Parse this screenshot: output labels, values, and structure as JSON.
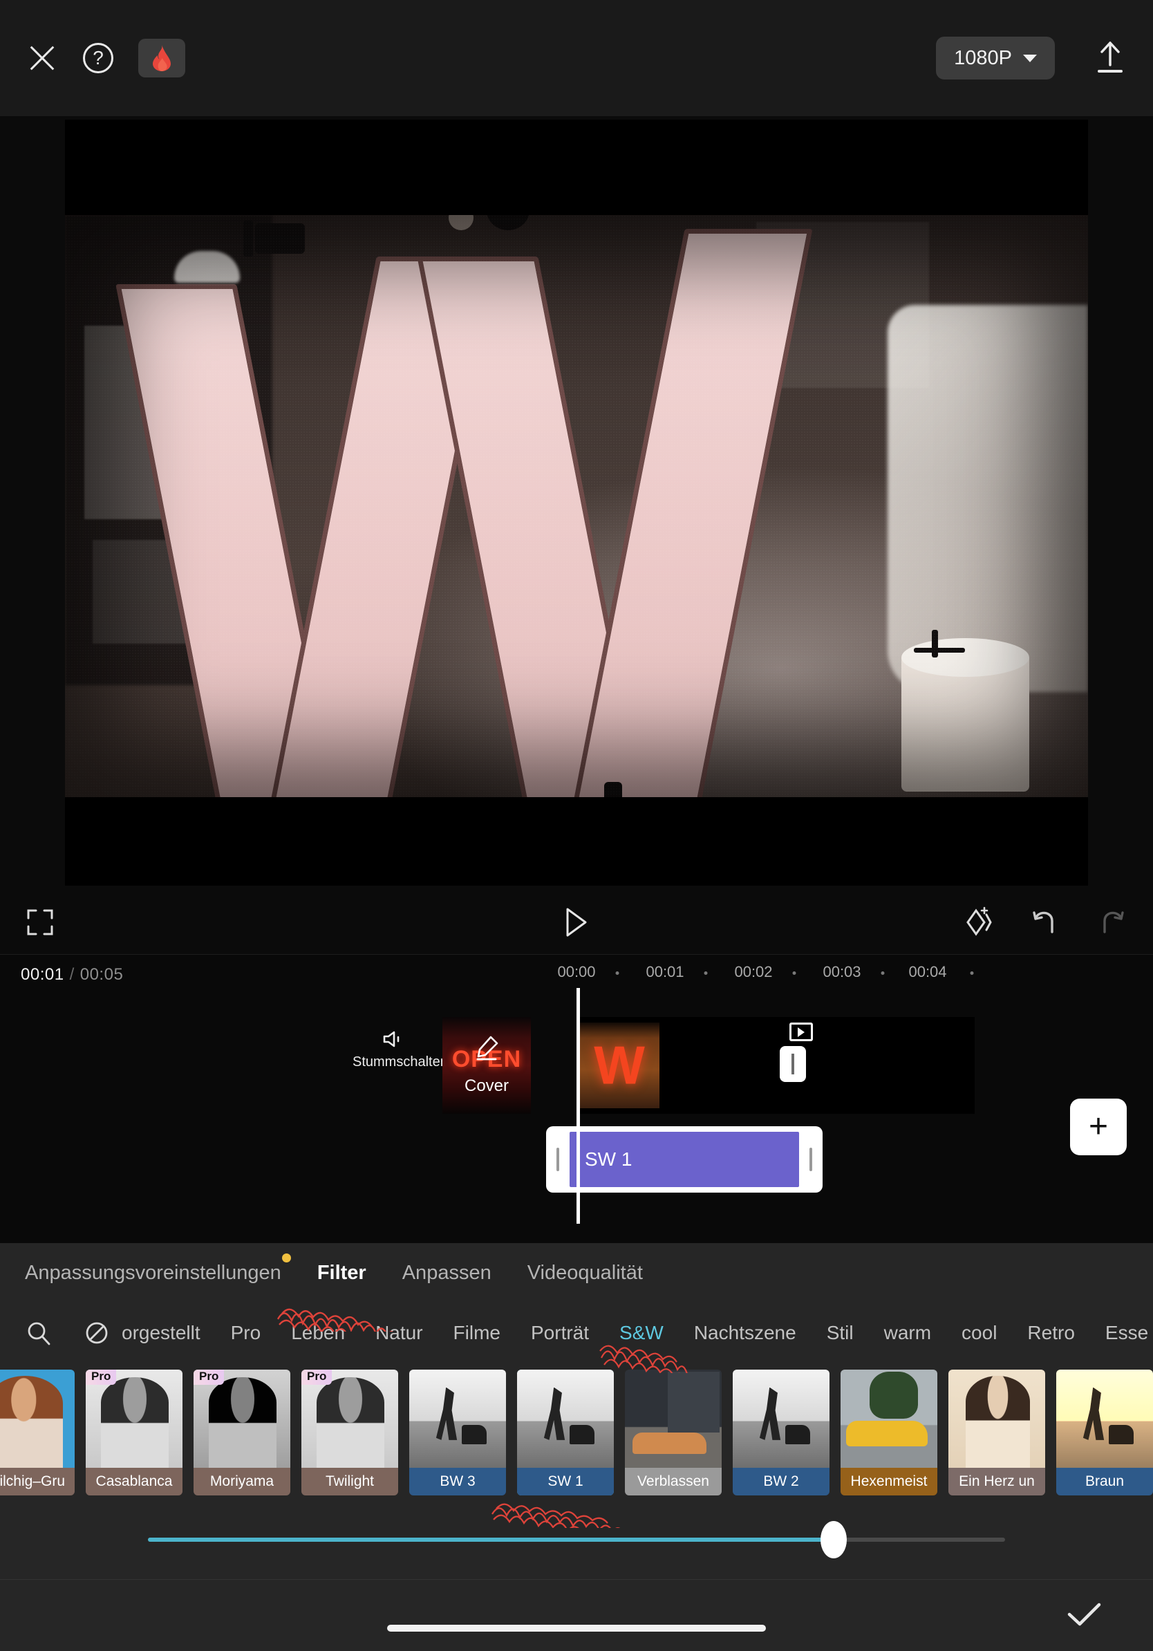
{
  "topbar": {
    "close_icon": "close-icon",
    "help_icon": "help-circle-icon",
    "flame_icon": "flame-icon",
    "resolution_label": "1080P",
    "export_icon": "export-upload-icon"
  },
  "preview": {
    "letter": "W"
  },
  "player": {
    "fullscreen_icon": "fullscreen-expand-icon",
    "play_icon": "play-icon",
    "keyframe_icon": "add-keyframe-icon",
    "undo_icon": "undo-icon",
    "redo_icon": "redo-icon"
  },
  "timeline": {
    "current_time": "00:01",
    "separator": "/",
    "total_time": "00:05",
    "ruler_ticks": [
      "00:00",
      "00:01",
      "00:02",
      "00:03",
      "00:04"
    ],
    "mute_label": "Stummschalten",
    "mute_icon": "speaker-mute-icon",
    "cover_label": "Cover",
    "cover_neon_text": "OPEN",
    "cover_edit_icon": "pencil-edit-icon",
    "clip_letter": "W",
    "video_badge_icon": "video-clip-icon",
    "filter_clip_label": "SW 1",
    "add_button_label": "+"
  },
  "panel": {
    "tabs": [
      {
        "label": "Anpassungsvoreinstellungen",
        "active": false,
        "badge": true
      },
      {
        "label": "Filter",
        "active": true,
        "badge": false
      },
      {
        "label": "Anpassen",
        "active": false,
        "badge": false
      },
      {
        "label": "Videoqualität",
        "active": false,
        "badge": false
      }
    ],
    "search_icon": "search-icon",
    "none_icon": "no-filter-icon",
    "categories": [
      {
        "label": "orgestellt",
        "active": false
      },
      {
        "label": "Pro",
        "active": false
      },
      {
        "label": "Leben",
        "active": false
      },
      {
        "label": "Natur",
        "active": false
      },
      {
        "label": "Filme",
        "active": false
      },
      {
        "label": "Porträt",
        "active": false
      },
      {
        "label": "S&W",
        "active": true
      },
      {
        "label": "Nachtszene",
        "active": false
      },
      {
        "label": "Stil",
        "active": false
      },
      {
        "label": "warm",
        "active": false
      },
      {
        "label": "cool",
        "active": false
      },
      {
        "label": "Retro",
        "active": false
      },
      {
        "label": "Esse",
        "active": false
      }
    ],
    "filters": [
      {
        "name": "Milchig–Gru",
        "pro": false,
        "selected": false,
        "art": "art-woman-blue",
        "cap": "cap-brown"
      },
      {
        "name": "Casablanca",
        "pro": true,
        "selected": false,
        "art": "art-bw-portrait",
        "cap": "cap-brown"
      },
      {
        "name": "Moriyama",
        "pro": true,
        "selected": false,
        "art": "art-bw-portrait dark",
        "cap": "cap-brown"
      },
      {
        "name": "Twilight",
        "pro": true,
        "selected": false,
        "art": "art-bw-portrait",
        "cap": "cap-brown"
      },
      {
        "name": "BW 3",
        "pro": false,
        "selected": false,
        "art": "art-walker",
        "cap": "cap-blue"
      },
      {
        "name": "SW 1",
        "pro": false,
        "selected": true,
        "art": "art-walker",
        "cap": "cap-blue"
      },
      {
        "name": "Verblassen",
        "pro": false,
        "selected": false,
        "art": "art-building",
        "cap": "cap-gray"
      },
      {
        "name": "BW 2",
        "pro": false,
        "selected": false,
        "art": "art-walker",
        "cap": "cap-blue"
      },
      {
        "name": "Hexenmeist",
        "pro": false,
        "selected": false,
        "art": "art-taxi",
        "cap": "cap-gold"
      },
      {
        "name": "Ein Herz un",
        "pro": false,
        "selected": false,
        "art": "art-sepia-portrait",
        "cap": "cap-mauve"
      },
      {
        "name": "Braun",
        "pro": false,
        "selected": false,
        "art": "art-walker sepia",
        "cap": "cap-blue"
      }
    ],
    "intensity_percent": 80,
    "confirm_icon": "check-icon"
  },
  "colors": {
    "accent": "#5ec8e0",
    "slider": "#4cb4cc",
    "filter_clip": "#6b62cc",
    "badge": "#f0c040",
    "annotation": "#e8453c"
  }
}
